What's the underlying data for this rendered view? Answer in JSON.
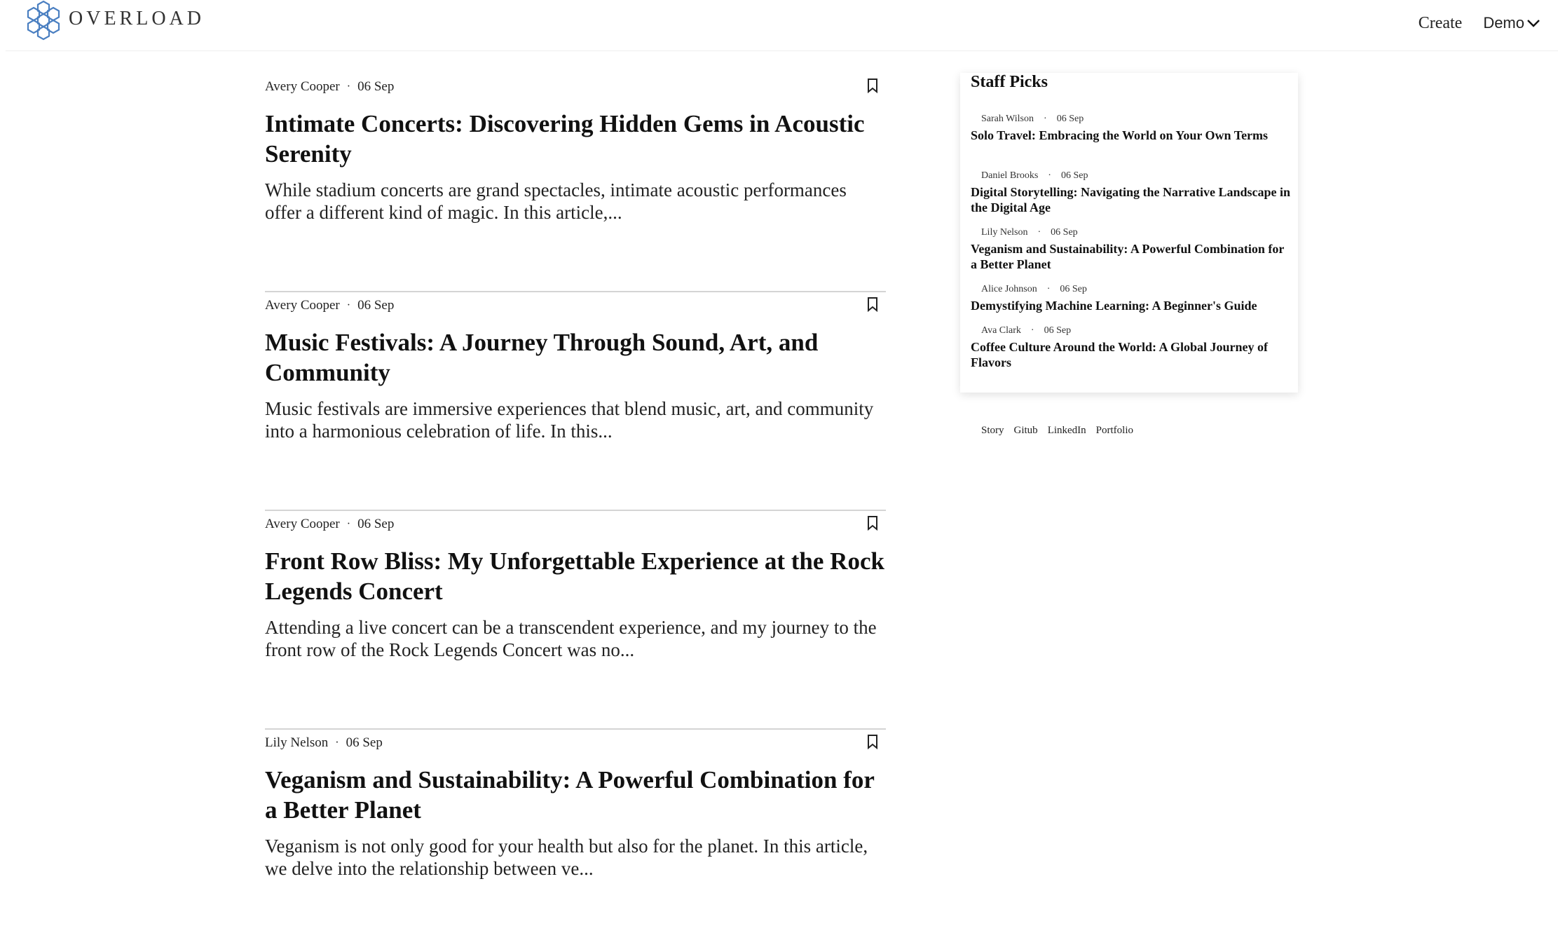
{
  "brand": {
    "name": "OVERLOAD",
    "logo_icon": "hexagon-cluster-icon",
    "accent": "#4a7fc1"
  },
  "nav": {
    "create_label": "Create",
    "user_label": "Demo",
    "user_icon": "chevron-down-icon"
  },
  "posts": [
    {
      "author": "Avery Cooper",
      "date": "06 Sep",
      "title": "Intimate Concerts: Discovering Hidden Gems in Acoustic Serenity",
      "excerpt": "While stadium concerts are grand spectacles, intimate acoustic performances offer a different kind of magic. In this article,..."
    },
    {
      "author": "Avery Cooper",
      "date": "06 Sep",
      "title": "Music Festivals: A Journey Through Sound, Art, and Community",
      "excerpt": "Music festivals are immersive experiences that blend music, art, and community into a harmonious celebration of life. In this..."
    },
    {
      "author": "Avery Cooper",
      "date": "06 Sep",
      "title": "Front Row Bliss: My Unforgettable Experience at the Rock Legends Concert",
      "excerpt": "Attending a live concert can be a transcendent experience, and my journey to the front row of the Rock Legends Concert was no..."
    },
    {
      "author": "Lily Nelson",
      "date": "06 Sep",
      "title": "Veganism and Sustainability: A Powerful Combination for a Better Planet",
      "excerpt": "Veganism is not only good for your health but also for the planet. In this article, we delve into the relationship between ve..."
    }
  ],
  "staff_picks": {
    "heading": "Staff Picks",
    "items": [
      {
        "author": "Sarah Wilson",
        "date": "06 Sep",
        "title": "Solo Travel: Embracing the World on Your Own Terms"
      },
      {
        "author": "Daniel Brooks",
        "date": "06 Sep",
        "title": "Digital Storytelling: Navigating the Narrative Landscape in the Digital Age"
      },
      {
        "author": "Lily Nelson",
        "date": "06 Sep",
        "title": "Veganism and Sustainability: A Powerful Combination for a Better Planet"
      },
      {
        "author": "Alice Johnson",
        "date": "06 Sep",
        "title": "Demystifying Machine Learning: A Beginner's Guide"
      },
      {
        "author": "Ava Clark",
        "date": "06 Sep",
        "title": "Coffee Culture Around the World: A Global Journey of Flavors"
      }
    ]
  },
  "footer_links": [
    "Story",
    "Gitub",
    "LinkedIn",
    "Portfolio"
  ],
  "separator": "·"
}
